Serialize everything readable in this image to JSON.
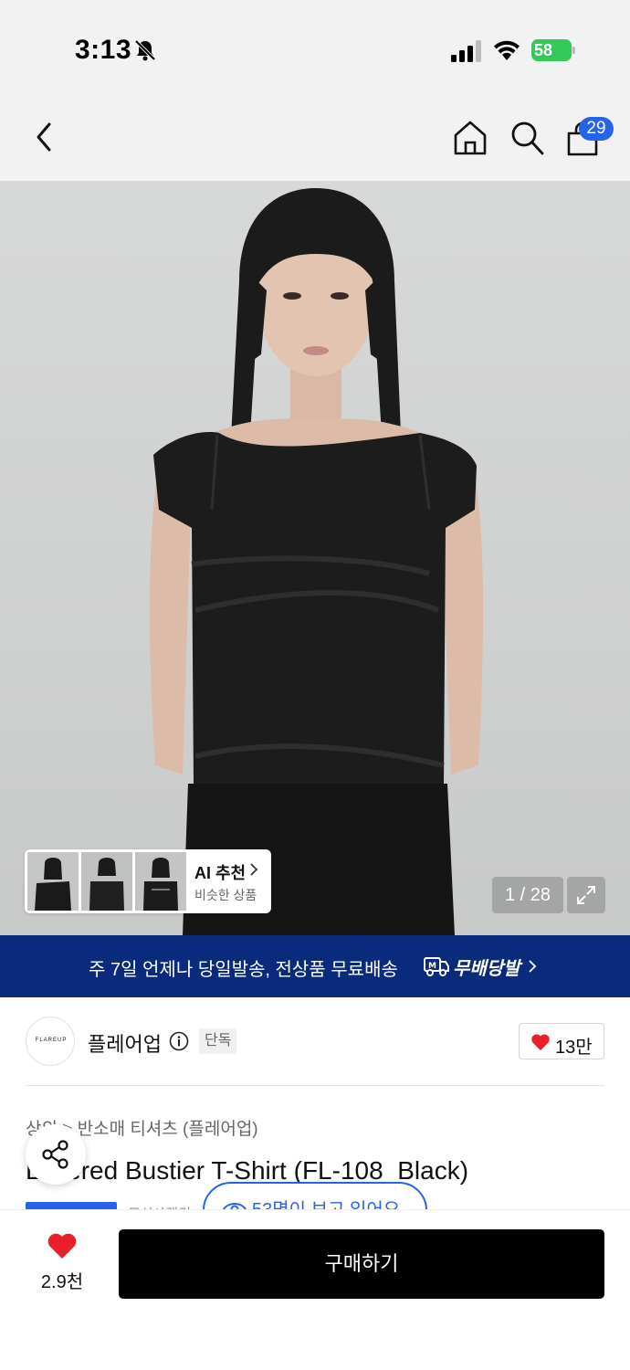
{
  "status_bar": {
    "time": "3:13",
    "battery": "58",
    "icons": [
      "bell-off-icon",
      "signal-icon",
      "wifi-icon",
      "battery-icon"
    ]
  },
  "nav": {
    "cart_count": "29",
    "icons": [
      "back-chevron-icon",
      "home-icon",
      "search-icon",
      "shopping-bag-icon"
    ]
  },
  "gallery": {
    "page_indicator": "1 / 28",
    "ai_card": {
      "title": "AI 추천",
      "subtitle": "비슷한 상품"
    }
  },
  "promo_banner": {
    "text": "주 7일 언제나 당일발송, 전상품 무료배송",
    "badge": "무배당발"
  },
  "brand": {
    "logo_text": "FLAREUP",
    "name": "플레어업",
    "exclusive_badge": "단독",
    "like_count": "13만"
  },
  "product": {
    "breadcrumb": "상의 > 반소매 티셔츠 (플레어업)",
    "title": "Layered Bustier T-Shirt (FL-108_Black)",
    "tag_partial": "무신사랭킹"
  },
  "viewers_text": "53명이 보고 있어요",
  "bottom_bar": {
    "like_count": "2.9천",
    "buy_label": "구매하기"
  },
  "colors": {
    "accent_blue": "#2563eb",
    "promo_navy": "#0a2a7c",
    "heart_red": "#e8202a",
    "battery_green": "#34c759"
  }
}
